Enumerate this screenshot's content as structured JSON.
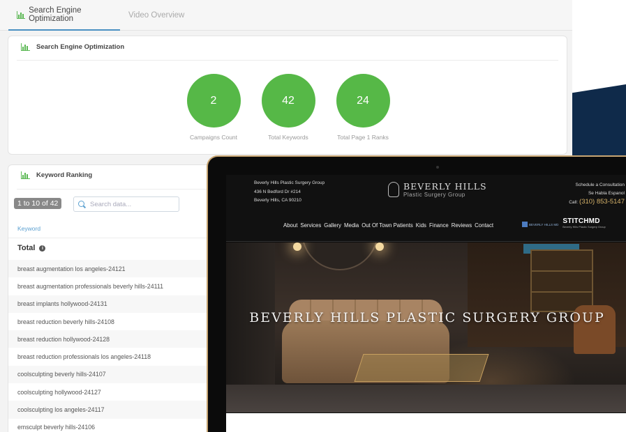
{
  "tabs": [
    {
      "label": "Search Engine Optimization",
      "active": true
    },
    {
      "label": "Video Overview",
      "active": false
    }
  ],
  "seo_card": {
    "title": "Search Engine Optimization",
    "stats": [
      {
        "value": "2",
        "label": "Campaigns Count"
      },
      {
        "value": "42",
        "label": "Total Keywords"
      },
      {
        "value": "24",
        "label": "Total Page 1 Ranks"
      }
    ]
  },
  "keyword_card": {
    "title": "Keyword Ranking",
    "count_text": "1 to 10 of 42",
    "search_placeholder": "Search data...",
    "column_header": "Keyword",
    "total_label": "Total",
    "keywords": [
      "breast augmentation los angeles-24121",
      "breast augmentation professionals beverly hills-24111",
      "breast implants hollywood-24131",
      "breast reduction beverly hills-24108",
      "breast reduction hollywood-24128",
      "breast reduction professionals los angeles-24118",
      "coolsculpting beverly hills-24107",
      "coolsculpting hollywood-24127",
      "coolsculpting los angeles-24117",
      "emsculpt beverly hills-24106"
    ]
  },
  "website": {
    "address_lines": [
      "Beverly Hills Plastic Surgery Group",
      "436 N Bedford Dr #214",
      "Beverly Hills, CA 90210"
    ],
    "logo_main": "BEVERLY HILLS",
    "logo_sub": "Plastic Surgery Group",
    "contact_line1": "Schedule a Consultation",
    "contact_line2": "Se Habla Espanol",
    "call_label": "Call:",
    "phone": "(310) 853-5147",
    "nav": [
      "About",
      "Services",
      "Gallery",
      "Media",
      "Out Of Town Patients",
      "Kids",
      "Finance",
      "Reviews",
      "Contact"
    ],
    "partner1": "BEVERLY HILLS MD",
    "partner2": "STITCHMD",
    "partner2_sub": "Beverly Hills Plastic Surgery Group",
    "hero_title": "BEVERLY HILLS PLASTIC SURGERY GROUP"
  },
  "colors": {
    "accent_green": "#56b847",
    "tab_underline": "#4a90c2",
    "navy": "#0f2a4a",
    "gold": "#d6b36a"
  }
}
